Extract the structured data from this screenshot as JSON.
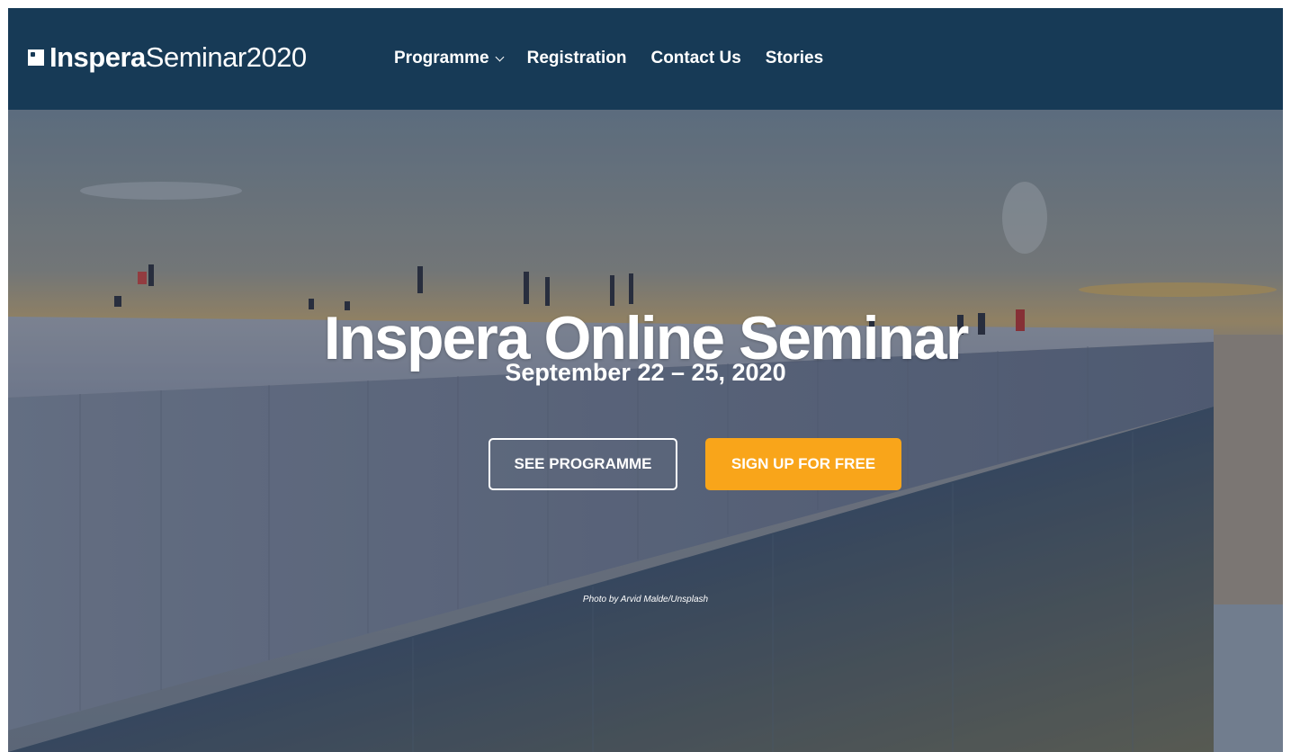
{
  "header": {
    "logo_bold": "Inspera",
    "logo_light": "Seminar2020",
    "nav": [
      {
        "label": "Programme",
        "has_dropdown": true
      },
      {
        "label": "Registration",
        "has_dropdown": false
      },
      {
        "label": "Contact Us",
        "has_dropdown": false
      },
      {
        "label": "Stories",
        "has_dropdown": false
      }
    ]
  },
  "hero": {
    "title": "Inspera Online Seminar",
    "date": "September 22 – 25, 2020",
    "primary_button": "SEE PROGRAMME",
    "secondary_button": "SIGN UP FOR FREE",
    "photo_credit": "Photo by Arvid Malde/Unsplash"
  },
  "colors": {
    "header_bg": "#173a56",
    "accent": "#f9a51a",
    "text": "#ffffff"
  },
  "icons": {
    "logo_mark": "square-logo-icon",
    "dropdown": "chevron-down-icon"
  }
}
